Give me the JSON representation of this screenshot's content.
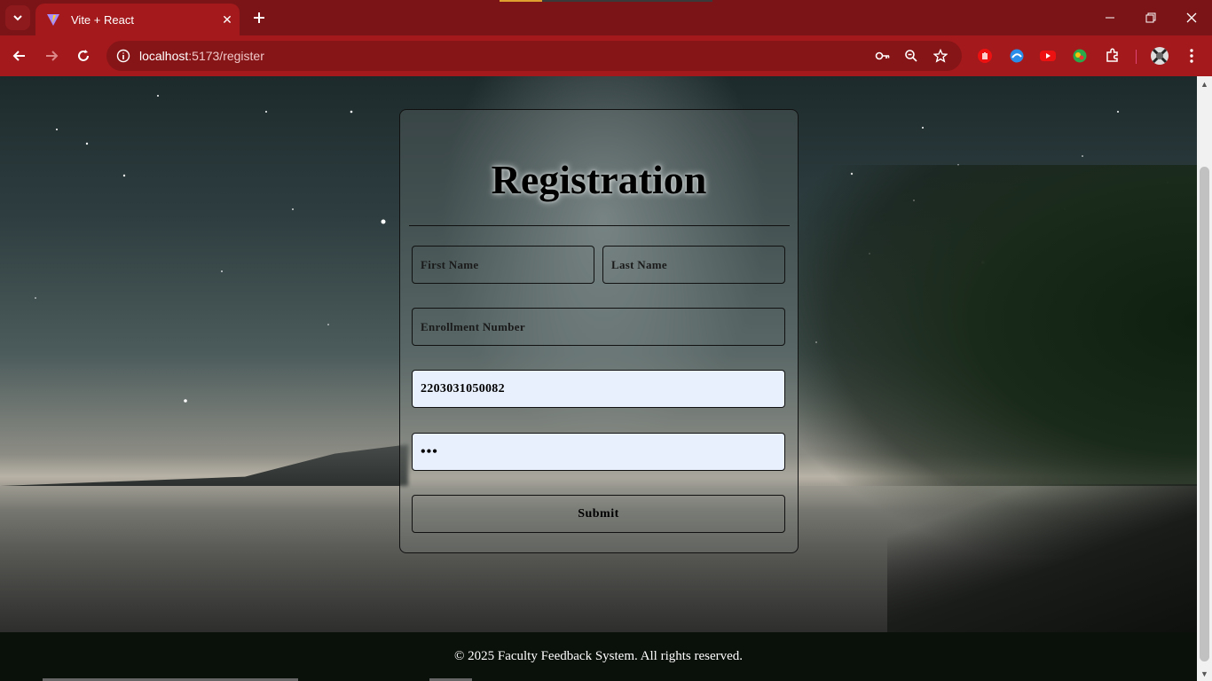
{
  "browser": {
    "tab_title": "Vite + React",
    "url_host": "localhost",
    "url_path": ":5173/register",
    "colors": {
      "chrome": "#a3191c",
      "tabbar": "#7a1416"
    },
    "icons": [
      "tab-search-icon",
      "vite-favicon-icon",
      "close-icon",
      "plus-icon",
      "minimize-icon",
      "restore-icon",
      "window-close-icon",
      "back-icon",
      "forward-icon",
      "reload-icon",
      "site-info-icon",
      "password-key-icon",
      "zoom-icon",
      "bookmark-star-icon",
      "extension-hand-icon",
      "extension-edge-icon",
      "extension-youtube-icon",
      "extension-globe-icon",
      "extensions-puzzle-icon",
      "profile-avatar-icon",
      "menu-kebab-icon"
    ]
  },
  "form": {
    "title": "Registration",
    "first_name_placeholder": "First Name",
    "last_name_placeholder": "Last Name",
    "enrollment_placeholder": "Enrollment Number",
    "username_value": "2203031050082",
    "password_value": "•••",
    "submit_label": "Submit",
    "autofill_color": "#e8f0fe"
  },
  "footer": {
    "text": "© 2025 Faculty Feedback System. All rights reserved."
  }
}
